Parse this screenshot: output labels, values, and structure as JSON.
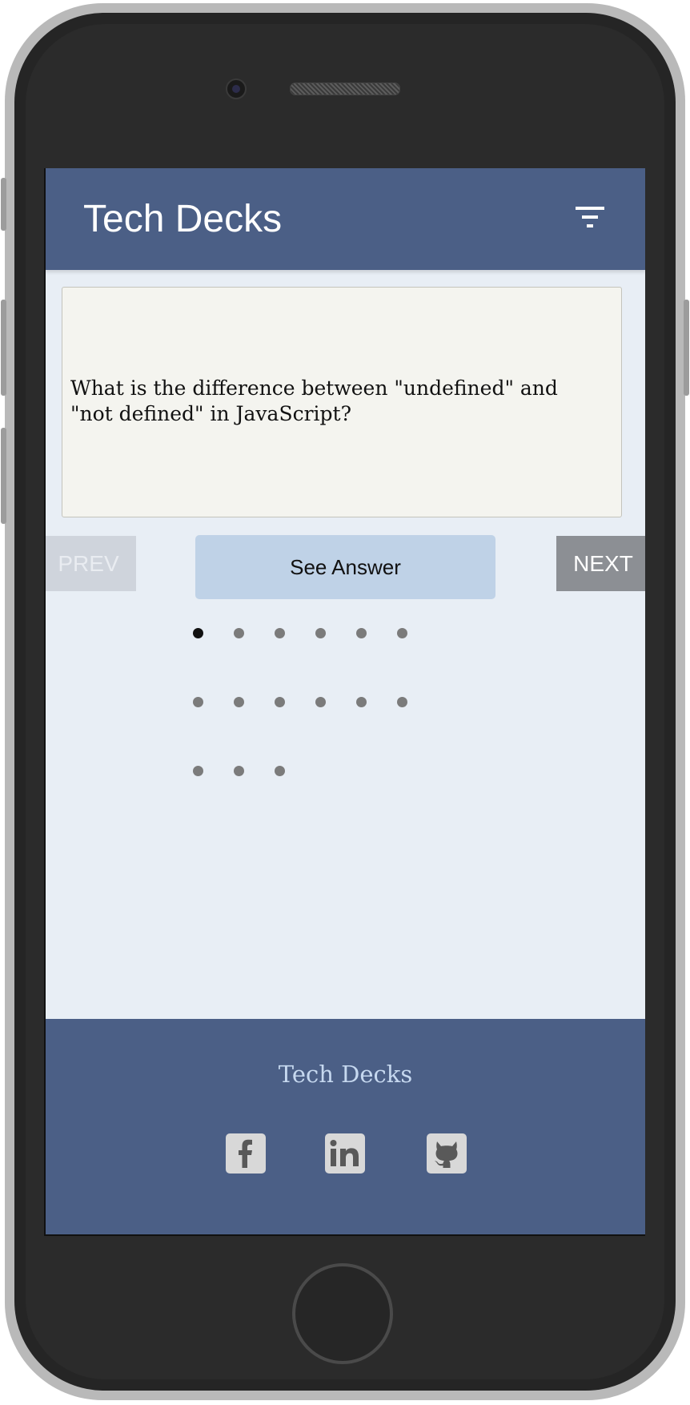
{
  "header": {
    "title": "Tech Decks",
    "filter_icon": "filter-list-icon"
  },
  "card": {
    "question": "What is the difference between \"undefined\" and \"not defined\" in JavaScript?"
  },
  "controls": {
    "prev_label": "PREV",
    "see_answer_label": "See Answer",
    "next_label": "NEXT"
  },
  "pagination": {
    "total": 15,
    "current": 1
  },
  "footer": {
    "title": "Tech Decks",
    "social": [
      {
        "name": "facebook-icon",
        "glyph": "f"
      },
      {
        "name": "linkedin-icon",
        "glyph": "in"
      },
      {
        "name": "github-icon",
        "glyph": "octocat"
      }
    ]
  },
  "colors": {
    "header_bg": "#4b5f86",
    "screen_bg": "#e8eef5",
    "card_bg": "#f4f4ef",
    "see_answer_bg": "#bfd2e7",
    "next_bg": "#8c8f94",
    "prev_bg": "#cfd4dc",
    "footer_title": "#c6d8ef",
    "dot_active": "#111111",
    "dot_inactive": "#7b7b7b"
  }
}
